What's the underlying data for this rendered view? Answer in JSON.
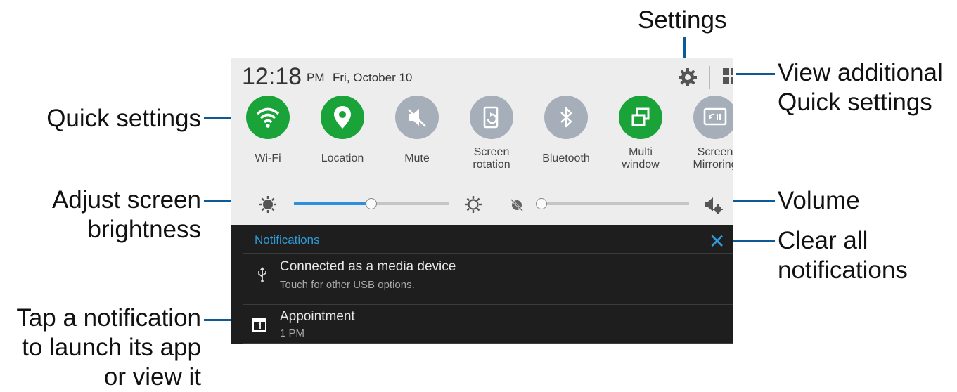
{
  "callouts": {
    "settings": "Settings",
    "view_additional_1": "View additional",
    "view_additional_2": "Quick settings",
    "quick_settings": "Quick settings",
    "adjust_brightness_1": "Adjust screen",
    "adjust_brightness_2": "brightness",
    "volume": "Volume",
    "clear_all_1": "Clear all",
    "clear_all_2": "notifications",
    "tap_notification_1": "Tap a notification",
    "tap_notification_2": "to launch its app",
    "tap_notification_3": "or view it"
  },
  "status_bar": {
    "time": "12:18",
    "ampm": "PM",
    "date": "Fri, October 10"
  },
  "quick_settings": [
    {
      "label": "Wi-Fi",
      "icon": "wifi-icon",
      "state": "on"
    },
    {
      "label": "Location",
      "icon": "location-pin-icon",
      "state": "on"
    },
    {
      "label": "Mute",
      "icon": "mute-icon",
      "state": "off"
    },
    {
      "label_1": "Screen",
      "label_2": "rotation",
      "icon": "screen-rotation-icon",
      "state": "off"
    },
    {
      "label": "Bluetooth",
      "icon": "bluetooth-icon",
      "state": "off"
    },
    {
      "label_1": "Multi",
      "label_2": "window",
      "icon": "multi-window-icon",
      "state": "on"
    },
    {
      "label_1": "Screen",
      "label_2": "Mirroring",
      "icon": "screen-mirroring-icon",
      "state": "off"
    }
  ],
  "brightness_level": 0.5,
  "volume_level": 0.0,
  "notifications": {
    "header": "Notifications",
    "items": [
      {
        "title": "Connected as a media device",
        "subtitle": "Touch for other USB options.",
        "icon": "usb-icon"
      },
      {
        "title": "Appointment",
        "subtitle": "1 PM",
        "icon": "calendar-icon"
      }
    ]
  },
  "colors": {
    "accent": "#2f9bd8",
    "on": "#1aa338",
    "off": "#a5aeb9",
    "leader": "#0d5a96"
  }
}
